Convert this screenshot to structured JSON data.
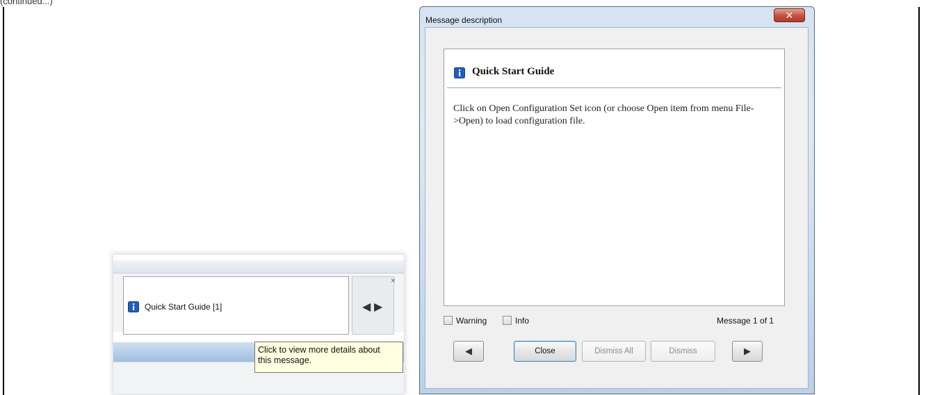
{
  "header_fragment": "(continued...)",
  "notification_bar": {
    "text": "Quick Start Guide [1]",
    "close_glyph": "×",
    "prev_glyph": "◀",
    "next_glyph": "▶",
    "tooltip_line1": "Click to view more details about",
    "tooltip_line2": "this message."
  },
  "dialog": {
    "title": "Message description",
    "close_glyph": "✕",
    "message_title": "Quick Start Guide",
    "message_body": "Click on Open Configuration Set icon (or choose Open item from menu File->Open) to load configuration file.",
    "filters": {
      "warning_label": "Warning",
      "info_label": "Info"
    },
    "counter": "Message 1 of 1",
    "buttons": {
      "prev_glyph": "◀",
      "close_label": "Close",
      "dismiss_all_label": "Dismiss All",
      "dismiss_label": "Dismiss",
      "next_glyph": "▶"
    }
  },
  "colors": {
    "info_icon": "#1f5fbf",
    "close_button": "#c7553f",
    "tooltip_bg": "#ffffe1"
  },
  "icons": [
    "info-icon",
    "hand-cursor-icon",
    "close-icon",
    "arrow-left-icon",
    "arrow-right-icon"
  ]
}
